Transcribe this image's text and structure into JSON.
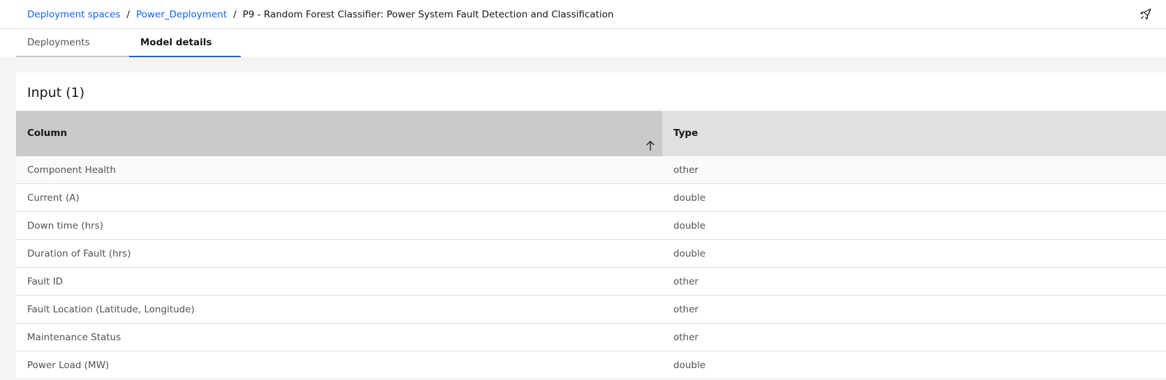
{
  "breadcrumb": {
    "items": [
      {
        "label": "Deployment spaces"
      },
      {
        "label": "Power_Deployment"
      }
    ],
    "separator": "/",
    "current": "P9 - Random Forest Classifier: Power System Fault Detection and Classification"
  },
  "header": {
    "action_icon": "rocket-icon"
  },
  "tabs": [
    {
      "label": "Deployments",
      "selected": false
    },
    {
      "label": "Model details",
      "selected": true
    }
  ],
  "input_section": {
    "title": "Input (1)",
    "columns": [
      {
        "label": "Column",
        "sorted": "ascending",
        "sort_icon": "arrow-up-icon"
      },
      {
        "label": "Type"
      }
    ],
    "rows": [
      {
        "column": "Component Health",
        "type": "other"
      },
      {
        "column": "Current (A)",
        "type": "double"
      },
      {
        "column": "Down time (hrs)",
        "type": "double"
      },
      {
        "column": "Duration of Fault (hrs)",
        "type": "double"
      },
      {
        "column": "Fault ID",
        "type": "other"
      },
      {
        "column": "Fault Location (Latitude, Longitude)",
        "type": "other"
      },
      {
        "column": "Maintenance Status",
        "type": "other"
      },
      {
        "column": "Power Load (MW)",
        "type": "double"
      }
    ]
  },
  "colors": {
    "link": "#0f62fe",
    "active_tab_underline": "#0f62fe",
    "sorted_header_bg": "#cacaca",
    "header_bg": "#e0e0e0",
    "page_bg": "#f4f4f4"
  }
}
